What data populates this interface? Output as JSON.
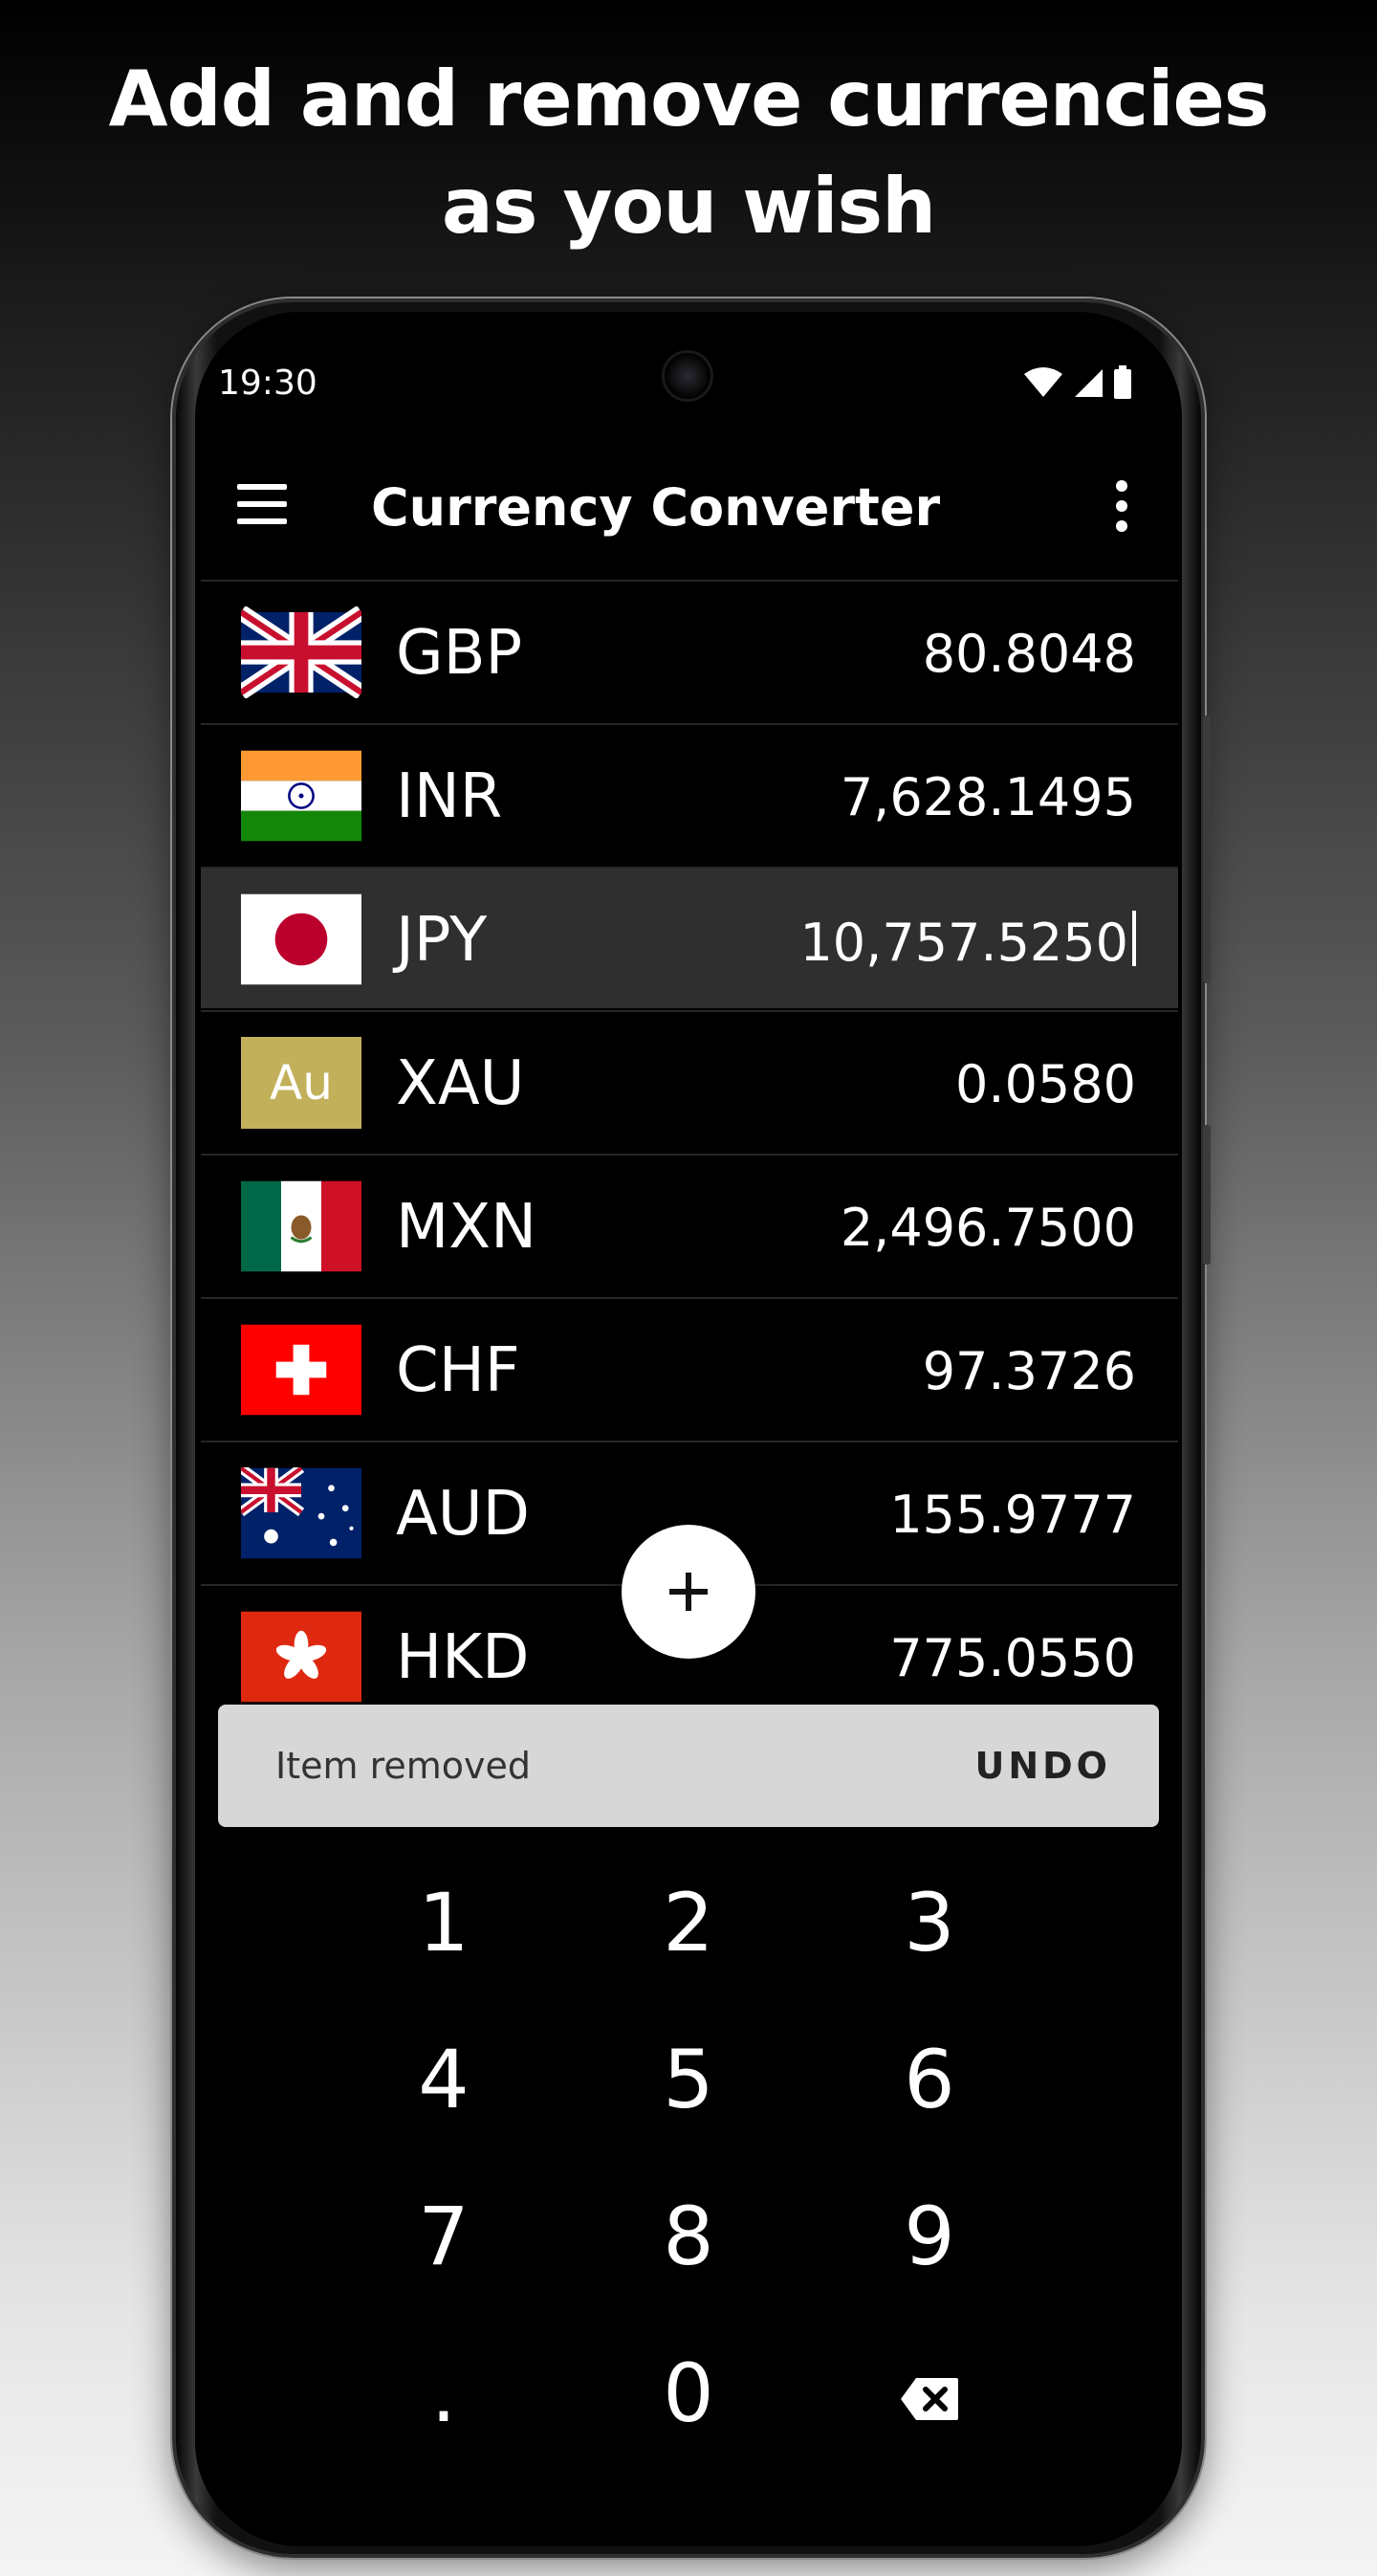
{
  "headline": {
    "line1": "Add and remove currencies",
    "line2": "as you wish"
  },
  "status_bar": {
    "time": "19:30",
    "icons": [
      "wifi-icon",
      "cell-signal-icon",
      "battery-icon"
    ]
  },
  "app_bar": {
    "title": "Currency Converter",
    "menu_icon": "hamburger-menu-icon",
    "overflow_icon": "more-vertical-icon"
  },
  "currencies": [
    {
      "code": "GBP",
      "value": "80.8048",
      "flag": "uk-flag-icon"
    },
    {
      "code": "INR",
      "value": "7,628.1495",
      "flag": "india-flag-icon"
    },
    {
      "code": "JPY",
      "value": "10,757.5250",
      "flag": "japan-flag-icon",
      "selected": true
    },
    {
      "code": "XAU",
      "value": "0.0580",
      "flag": "gold-icon",
      "badge": "Au"
    },
    {
      "code": "MXN",
      "value": "2,496.7500",
      "flag": "mexico-flag-icon"
    },
    {
      "code": "CHF",
      "value": "97.3726",
      "flag": "switzerland-flag-icon"
    },
    {
      "code": "AUD",
      "value": "155.9777",
      "flag": "australia-flag-icon"
    },
    {
      "code": "HKD",
      "value": "775.0550",
      "flag": "hong-kong-flag-icon"
    }
  ],
  "fab": {
    "icon": "plus-icon"
  },
  "snackbar": {
    "message": "Item removed",
    "action": "UNDO"
  },
  "keypad": {
    "keys": [
      "1",
      "2",
      "3",
      "4",
      "5",
      "6",
      "7",
      "8",
      "9",
      ".",
      "0"
    ],
    "backspace_icon": "backspace-icon"
  },
  "colors": {
    "screen_bg": "#000000",
    "selected_row": "#2f2f2f",
    "snackbar_bg": "#d7d7d7",
    "fab_bg": "#ffffff",
    "gold": "#c2b05a"
  }
}
